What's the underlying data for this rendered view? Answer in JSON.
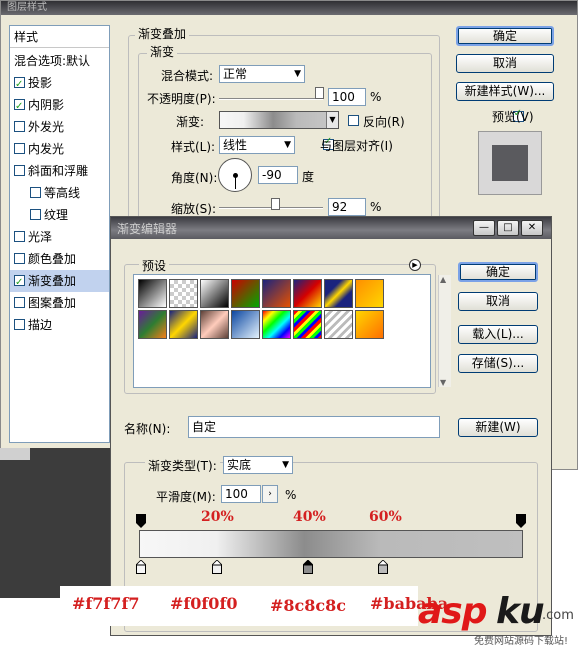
{
  "layer_style": {
    "title": "图层样式",
    "left_panel": {
      "header": "样式",
      "items": [
        {
          "label": "混合选项:默认",
          "checkbox": false,
          "indent": false,
          "selected": false
        },
        {
          "label": "投影",
          "checkbox": true,
          "checked": true,
          "indent": false,
          "selected": false
        },
        {
          "label": "内阴影",
          "checkbox": true,
          "checked": true,
          "indent": false,
          "selected": false
        },
        {
          "label": "外发光",
          "checkbox": true,
          "checked": false,
          "indent": false,
          "selected": false
        },
        {
          "label": "内发光",
          "checkbox": true,
          "checked": false,
          "indent": false,
          "selected": false
        },
        {
          "label": "斜面和浮雕",
          "checkbox": true,
          "checked": false,
          "indent": false,
          "selected": false
        },
        {
          "label": "等高线",
          "checkbox": true,
          "checked": false,
          "indent": true,
          "selected": false
        },
        {
          "label": "纹理",
          "checkbox": true,
          "checked": false,
          "indent": true,
          "selected": false
        },
        {
          "label": "光泽",
          "checkbox": true,
          "checked": false,
          "indent": false,
          "selected": false
        },
        {
          "label": "颜色叠加",
          "checkbox": true,
          "checked": false,
          "indent": false,
          "selected": false
        },
        {
          "label": "渐变叠加",
          "checkbox": true,
          "checked": true,
          "indent": false,
          "selected": true
        },
        {
          "label": "图案叠加",
          "checkbox": true,
          "checked": false,
          "indent": false,
          "selected": false
        },
        {
          "label": "描边",
          "checkbox": true,
          "checked": false,
          "indent": false,
          "selected": false
        }
      ]
    },
    "overlay": {
      "section_title": "渐变叠加",
      "group_title": "渐变",
      "blend_mode_label": "混合模式:",
      "blend_mode_value": "正常",
      "opacity_label": "不透明度(P):",
      "opacity_value": "100",
      "opacity_unit": "%",
      "opacity_level": 1.0,
      "gradient_label": "渐变:",
      "reverse_label": "反向(R)",
      "style_label": "样式(L):",
      "style_value": "线性",
      "align_label": "与图层对齐(I)",
      "angle_label": "角度(N):",
      "angle_value": "-90",
      "angle_unit": "度",
      "scale_label": "缩放(S):",
      "scale_value": "92",
      "scale_unit": "%",
      "scale_level": 0.92
    },
    "buttons": {
      "ok": "确定",
      "cancel": "取消",
      "new_style": "新建样式(W)...",
      "preview": "预览(V)"
    }
  },
  "gradient_editor": {
    "title": "渐变编辑器",
    "presets_label": "预设",
    "buttons": {
      "ok": "确定",
      "cancel": "取消",
      "load": "载入(L)...",
      "save": "存储(S)...",
      "new": "新建(W)"
    },
    "name_label": "名称(N):",
    "name_value": "自定",
    "type_label": "渐变类型(T):",
    "type_value": "实底",
    "smooth_label": "平滑度(M):",
    "smooth_value": "100",
    "smooth_unit": "%",
    "percent_marks": [
      "20%",
      "40%",
      "60%"
    ],
    "stop_colors": [
      "#f7f7f7",
      "#f0f0f0",
      "#8c8c8c",
      "#bababa"
    ]
  },
  "annotations": {
    "hex_labels": [
      "#f7f7f7",
      "#f0f0f0",
      "#8c8c8c",
      "#bababa"
    ]
  },
  "watermark": {
    "brand": "asp",
    "brand2": "ku",
    "com": ".com",
    "tagline": "免费网站源码下载站!"
  },
  "colors": {
    "dialog_bg": "#ece9d8",
    "annotation_red": "#d42020",
    "selection": "#c1d2ee"
  }
}
